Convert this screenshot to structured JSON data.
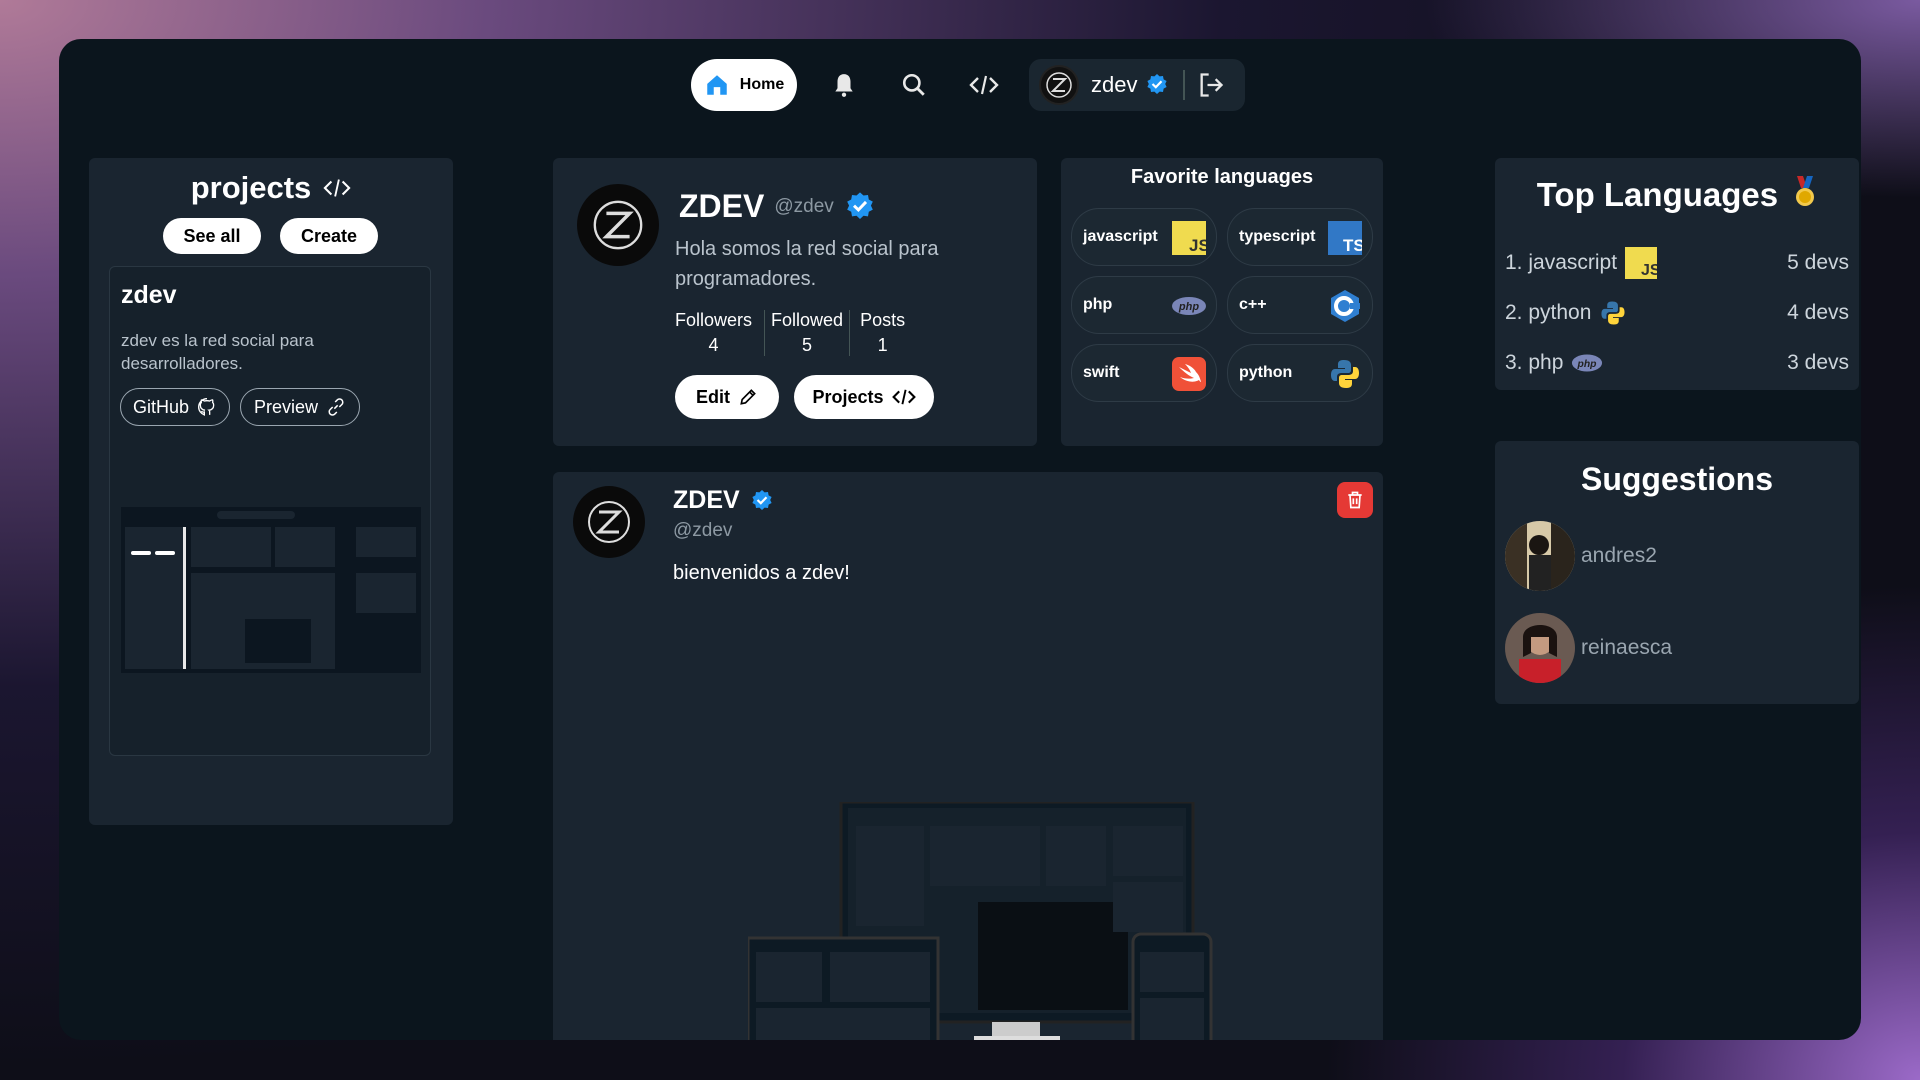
{
  "nav": {
    "home_label": "Home",
    "icons": [
      "home-icon",
      "bell-icon",
      "search-icon",
      "code-icon",
      "logout-icon"
    ],
    "username": "zdev"
  },
  "projects": {
    "title": "projects",
    "see_all": "See all",
    "create": "Create",
    "card": {
      "name": "zdev",
      "description": "zdev es la red social para desarrolladores.",
      "github": "GitHub",
      "preview": "Preview"
    }
  },
  "profile": {
    "name": "ZDEV",
    "handle": "@zdev",
    "bio": "Hola somos la red social para programadores.",
    "stats": [
      {
        "label": "Followers",
        "value": "4"
      },
      {
        "label": "Followed",
        "value": "5"
      },
      {
        "label": "Posts",
        "value": "1"
      }
    ],
    "edit": "Edit",
    "projects": "Projects"
  },
  "favorite_languages": {
    "title": "Favorite languages",
    "items": [
      {
        "name": "javascript",
        "icon": "javascript-icon",
        "color": "#f0db4f"
      },
      {
        "name": "typescript",
        "icon": "typescript-icon",
        "color": "#3178c6"
      },
      {
        "name": "php",
        "icon": "php-icon",
        "color": "#7a86b8"
      },
      {
        "name": "c++",
        "icon": "cpp-icon",
        "color": "#2f7fd1"
      },
      {
        "name": "swift",
        "icon": "swift-icon",
        "color": "#f05138"
      },
      {
        "name": "python",
        "icon": "python-icon",
        "color": "#3776ab"
      }
    ]
  },
  "post": {
    "author": "ZDEV",
    "handle": "@zdev",
    "text": "bienvenidos a zdev!"
  },
  "top_languages": {
    "title": "Top Languages",
    "items": [
      {
        "rank": "1. javascript",
        "count": "5 devs",
        "icon": "javascript-icon"
      },
      {
        "rank": "2. python",
        "count": "4 devs",
        "icon": "python-icon"
      },
      {
        "rank": "3. php",
        "count": "3 devs",
        "icon": "php-icon"
      }
    ]
  },
  "suggestions": {
    "title": "Suggestions",
    "users": [
      {
        "name": "andres2"
      },
      {
        "name": "reinaesca"
      }
    ]
  },
  "colors": {
    "app_bg": "#0b151d",
    "panel_bg": "#1a2530",
    "verified": "#2196f3",
    "delete": "#e53935"
  }
}
